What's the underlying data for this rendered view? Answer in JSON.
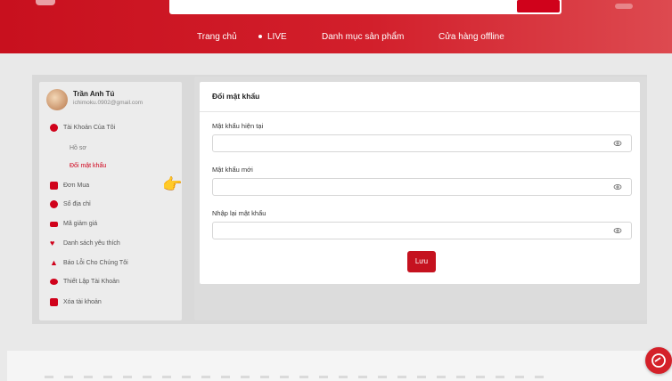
{
  "header": {
    "nav": [
      {
        "label": "Trang chủ"
      },
      {
        "label": "LIVE"
      },
      {
        "label": "Danh mục sản phẩm"
      },
      {
        "label": "Cửa hàng offline"
      }
    ]
  },
  "user": {
    "name": "Trần Anh Tú",
    "email": "ichimoku.0902@gmail.com"
  },
  "sidebar": {
    "items": [
      {
        "label": "Tài Khoản Của Tôi",
        "icon": "user-icon"
      },
      {
        "label": "Hồ sơ"
      },
      {
        "label": "Đổi mật khẩu"
      },
      {
        "label": "Đơn Mua",
        "icon": "order-icon"
      },
      {
        "label": "Sổ địa chỉ",
        "icon": "location-icon"
      },
      {
        "label": "Mã giảm giá",
        "icon": "voucher-icon"
      },
      {
        "label": "Danh sách yêu thích",
        "icon": "heart-icon"
      },
      {
        "label": "Báo Lỗi Cho Chúng Tôi",
        "icon": "warning-icon"
      },
      {
        "label": "Thiết Lập Tài Khoản",
        "icon": "user-settings-icon"
      },
      {
        "label": "Xóa tài khoản",
        "icon": "trash-icon"
      }
    ]
  },
  "form": {
    "title": "Đổi mật khẩu",
    "fields": [
      {
        "label": "Mật khẩu hiện tại",
        "value": ""
      },
      {
        "label": "Mật khẩu mới",
        "value": ""
      },
      {
        "label": "Nhập lại mật khẩu",
        "value": ""
      }
    ],
    "submit_label": "Lưu"
  },
  "colors": {
    "brand_red": "#d0021b",
    "header_gradient_start": "#c8101e",
    "header_gradient_end": "#dd4a50"
  }
}
